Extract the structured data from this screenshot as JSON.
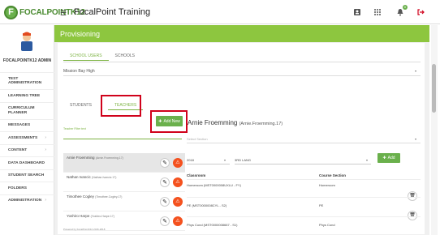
{
  "app": {
    "logo_letter": "F",
    "logo_text": "FOCALPOINTK12",
    "title": "FocalPoint Training",
    "badge_count": "0"
  },
  "sidebar": {
    "org": "FOCALPOINTK12 ADMIN",
    "items": [
      {
        "label": "TEST ADMINISTRATION",
        "chevron": false
      },
      {
        "label": "LEARNING TREE",
        "chevron": false
      },
      {
        "label": "CURRICULUM PLANNER",
        "chevron": false
      },
      {
        "label": "MESSAGES",
        "chevron": false
      },
      {
        "label": "ASSESSMENTS",
        "chevron": true
      },
      {
        "label": "CONTENT",
        "chevron": true
      },
      {
        "label": "DATA DASHBOARD",
        "chevron": false
      },
      {
        "label": "STUDENT SEARCH",
        "chevron": false
      },
      {
        "label": "FOLDERS",
        "chevron": false
      },
      {
        "label": "ADMINISTRATION",
        "chevron": true
      }
    ]
  },
  "page": {
    "title": "Provisioning"
  },
  "tabs_top": {
    "school_users": "SCHOOL USERS",
    "schools": "SCHOOLS"
  },
  "school": "Mission Bay High",
  "tabs_mid": {
    "students": "STUDENTS",
    "teachers": "TEACHERS"
  },
  "filter": {
    "label": "Teacher Filter text"
  },
  "add_new": "Add New",
  "selected_teacher": {
    "name": "Arnie Froemming",
    "username": "(Arnie.Froemming.17)"
  },
  "select_section": "Select Section",
  "teachers": [
    {
      "name": "Arnie Froemming",
      "username": "(Arnie.Froemming.17)"
    },
    {
      "name": "Nathan Ivancic",
      "username": "(Nathan.Ivancic.17)"
    },
    {
      "name": "Timothee Cogley",
      "username": "(Timothee.Cogley.17)"
    },
    {
      "name": "Yoshiro Harpe",
      "username": "(Yoshiro.Harpe.17)"
    }
  ],
  "year": "2018",
  "period": "3RD LANG",
  "add_label": "Add",
  "class_table": {
    "headers": [
      "Classroom",
      "Course Section"
    ],
    "rows": [
      {
        "classroom": "Homeroom (MST0000008UXLU - FY)",
        "section": "Homeroom"
      },
      {
        "classroom": "PE (MST0000008CYL - S2)",
        "section": "PE"
      },
      {
        "classroom": "Phys Cond (MST0000008667 - S1)",
        "section": "Phys Cond"
      }
    ]
  },
  "footer": "Powered by FocalPointK12 2016-2018",
  "colors": {
    "green": "#8dc63f",
    "button_green": "#6ab04c",
    "highlight_red": "#d0021b",
    "delete_orange": "#f4511e"
  }
}
